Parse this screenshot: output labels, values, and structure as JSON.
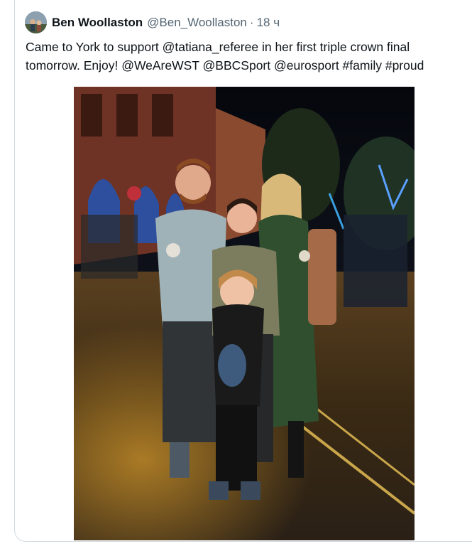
{
  "tweet": {
    "author_name": "Ben Woollaston",
    "author_handle": "@Ben_Woollaston",
    "separator": "·",
    "time": "18 ч",
    "text_line1": "Came to York to support @tatiana_referee in her first triple crown final",
    "text_line2": "tomorrow. Enjoy! @WeAreWST @BBCSport @eurosport #family #proud"
  },
  "media": {
    "photo_subject": "family-street-photo"
  },
  "colors": {
    "text": "#0f1419",
    "secondary": "#536471",
    "border": "#cfd9de"
  },
  "icons": {
    "avatar": "profile-avatar"
  }
}
